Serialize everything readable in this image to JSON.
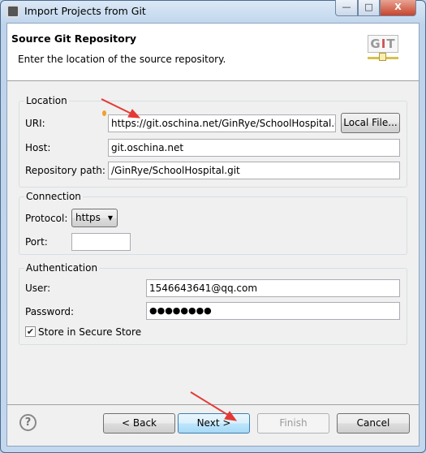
{
  "window": {
    "title": "Import Projects from Git",
    "minimize": "—",
    "maximize": "□",
    "close": "X"
  },
  "header": {
    "title": "Source Git Repository",
    "description": "Enter the location of the source repository.",
    "icon_text": "GIT"
  },
  "location": {
    "legend": "Location",
    "uri_label": "URI:",
    "uri_value": "https://git.oschina.net/GinRye/SchoolHospital.git",
    "local_file_button": "Local File...",
    "host_label": "Host:",
    "host_value": "git.oschina.net",
    "path_label": "Repository path:",
    "path_value": "/GinRye/SchoolHospital.git"
  },
  "connection": {
    "legend": "Connection",
    "protocol_label": "Protocol:",
    "protocol_value": "https",
    "port_label": "Port:",
    "port_value": ""
  },
  "authentication": {
    "legend": "Authentication",
    "user_label": "User:",
    "user_value": "1546643641@qq.com",
    "password_label": "Password:",
    "password_value": "●●●●●●●●",
    "store_label": "Store in Secure Store",
    "store_checked": true
  },
  "footer": {
    "help": "?",
    "back": "< Back",
    "next": "Next >",
    "finish": "Finish",
    "cancel": "Cancel"
  },
  "annotation_color": "#e53935"
}
